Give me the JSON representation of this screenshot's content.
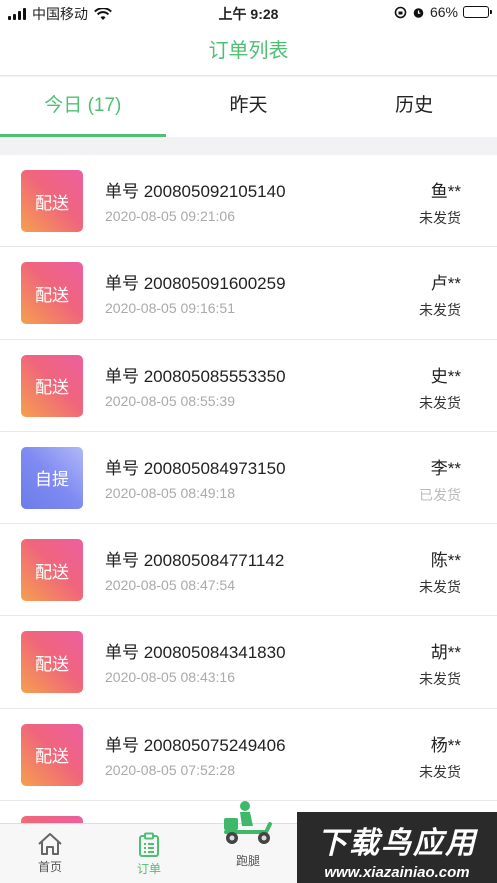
{
  "status_bar": {
    "carrier": "中国移动",
    "time": "上午 9:28",
    "battery": "66%",
    "battery_level": 0.66
  },
  "header": {
    "title": "订单列表"
  },
  "tabs": [
    {
      "label": "今日 (17)",
      "active": true
    },
    {
      "label": "昨天",
      "active": false
    },
    {
      "label": "历史",
      "active": false
    }
  ],
  "orders": [
    {
      "type": "配送",
      "type_kind": "ship",
      "order_no": "单号 200805092105140",
      "time": "2020-08-05 09:21:06",
      "customer": "鱼**",
      "status": "未发货"
    },
    {
      "type": "配送",
      "type_kind": "ship",
      "order_no": "单号 200805091600259",
      "time": "2020-08-05 09:16:51",
      "customer": "卢**",
      "status": "未发货"
    },
    {
      "type": "配送",
      "type_kind": "ship",
      "order_no": "单号 200805085553350",
      "time": "2020-08-05 08:55:39",
      "customer": "史**",
      "status": "未发货"
    },
    {
      "type": "自提",
      "type_kind": "pick",
      "order_no": "单号 200805084973150",
      "time": "2020-08-05 08:49:18",
      "customer": "李**",
      "status": "已发货"
    },
    {
      "type": "配送",
      "type_kind": "ship",
      "order_no": "单号 200805084771142",
      "time": "2020-08-05 08:47:54",
      "customer": "陈**",
      "status": "未发货"
    },
    {
      "type": "配送",
      "type_kind": "ship",
      "order_no": "单号 200805084341830",
      "time": "2020-08-05 08:43:16",
      "customer": "胡**",
      "status": "未发货"
    },
    {
      "type": "配送",
      "type_kind": "ship",
      "order_no": "单号 200805075249406",
      "time": "2020-08-05 07:52:28",
      "customer": "杨**",
      "status": "未发货"
    }
  ],
  "bottom_nav": [
    {
      "label": "首页",
      "icon": "home-icon",
      "active": false
    },
    {
      "label": "订单",
      "icon": "clipboard-icon",
      "active": true
    },
    {
      "label": "跑腿",
      "icon": "scooter-rider-icon",
      "active": false
    }
  ],
  "watermark": {
    "title": "下载鸟应用",
    "url": "www.xiazainiao.com"
  },
  "colors": {
    "accent": "#4fbf74",
    "ship_badge": "#f0657d",
    "pick_badge": "#7f8af2"
  }
}
